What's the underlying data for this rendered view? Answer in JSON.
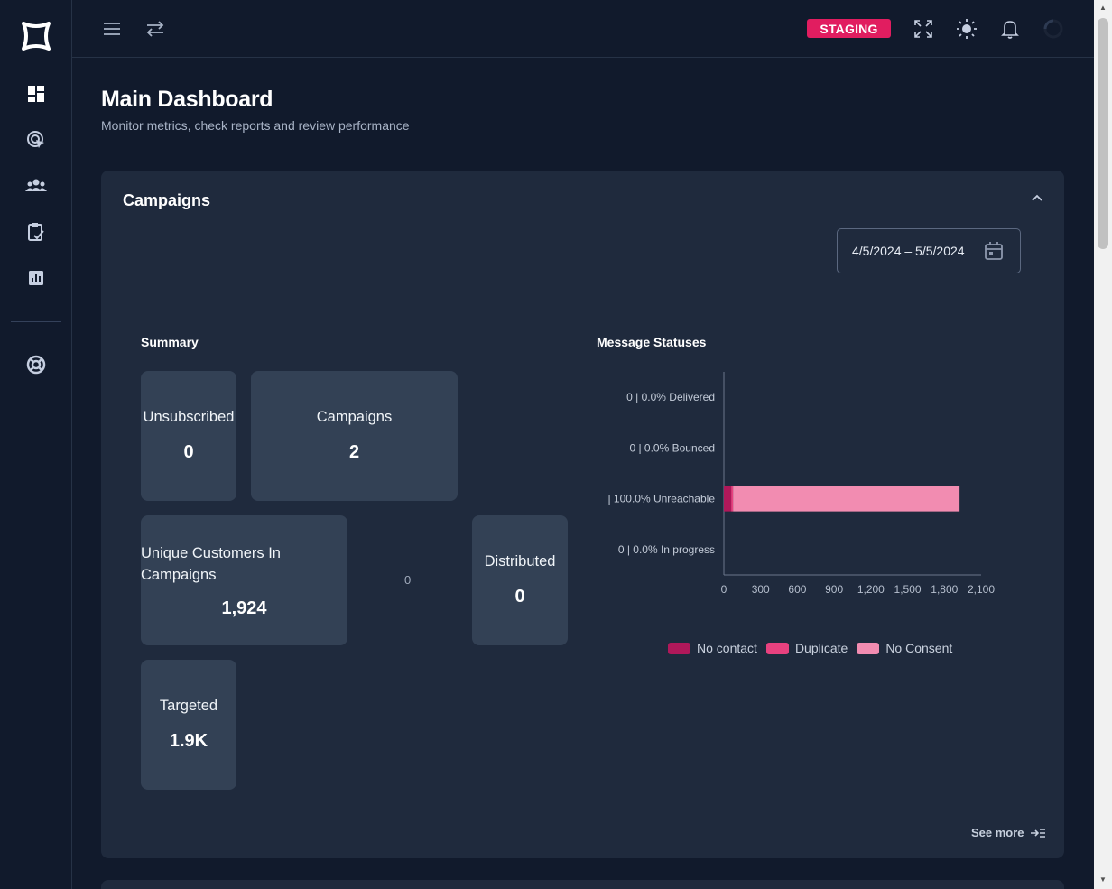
{
  "topbar": {
    "env_badge": "STAGING"
  },
  "page": {
    "title": "Main Dashboard",
    "subtitle": "Monitor metrics, check reports and review performance"
  },
  "campaigns": {
    "title": "Campaigns",
    "date_range": "4/5/2024 – 5/5/2024",
    "summary_label": "Summary",
    "tiles": {
      "unsubscribed": {
        "label": "Unsubscribed",
        "value": "0"
      },
      "campaigns": {
        "label": "Campaigns",
        "value": "2"
      },
      "unique_customers": {
        "label": "Unique Customers In Campaigns",
        "value": "1,924"
      },
      "distributed": {
        "label": "Distributed",
        "value": "0"
      },
      "targeted": {
        "label": "Targeted",
        "value": "1.9K"
      }
    },
    "middle_zero": "0",
    "see_more": "See more"
  },
  "chart_data": {
    "type": "bar",
    "orientation": "horizontal",
    "stacked": true,
    "title": "Message Statuses",
    "categories": [
      "Delivered",
      "Bounced",
      "Unreachable",
      "In progress"
    ],
    "category_prefix": [
      "0 | 0.0%",
      "0 | 0.0%",
      "| 100.0%",
      "0 | 0.0%"
    ],
    "series": [
      {
        "name": "No contact",
        "color": "#b0185a",
        "values": [
          0,
          0,
          60,
          0
        ]
      },
      {
        "name": "Duplicate",
        "color": "#e8417f",
        "values": [
          0,
          0,
          15,
          0
        ]
      },
      {
        "name": "No Consent",
        "color": "#f28cb1",
        "values": [
          0,
          0,
          1849,
          0
        ]
      }
    ],
    "xlim": [
      0,
      2100
    ],
    "xticks": [
      "0",
      "300",
      "600",
      "900",
      "1,200",
      "1,500",
      "1,800",
      "2,100"
    ],
    "legend_position": "bottom"
  }
}
